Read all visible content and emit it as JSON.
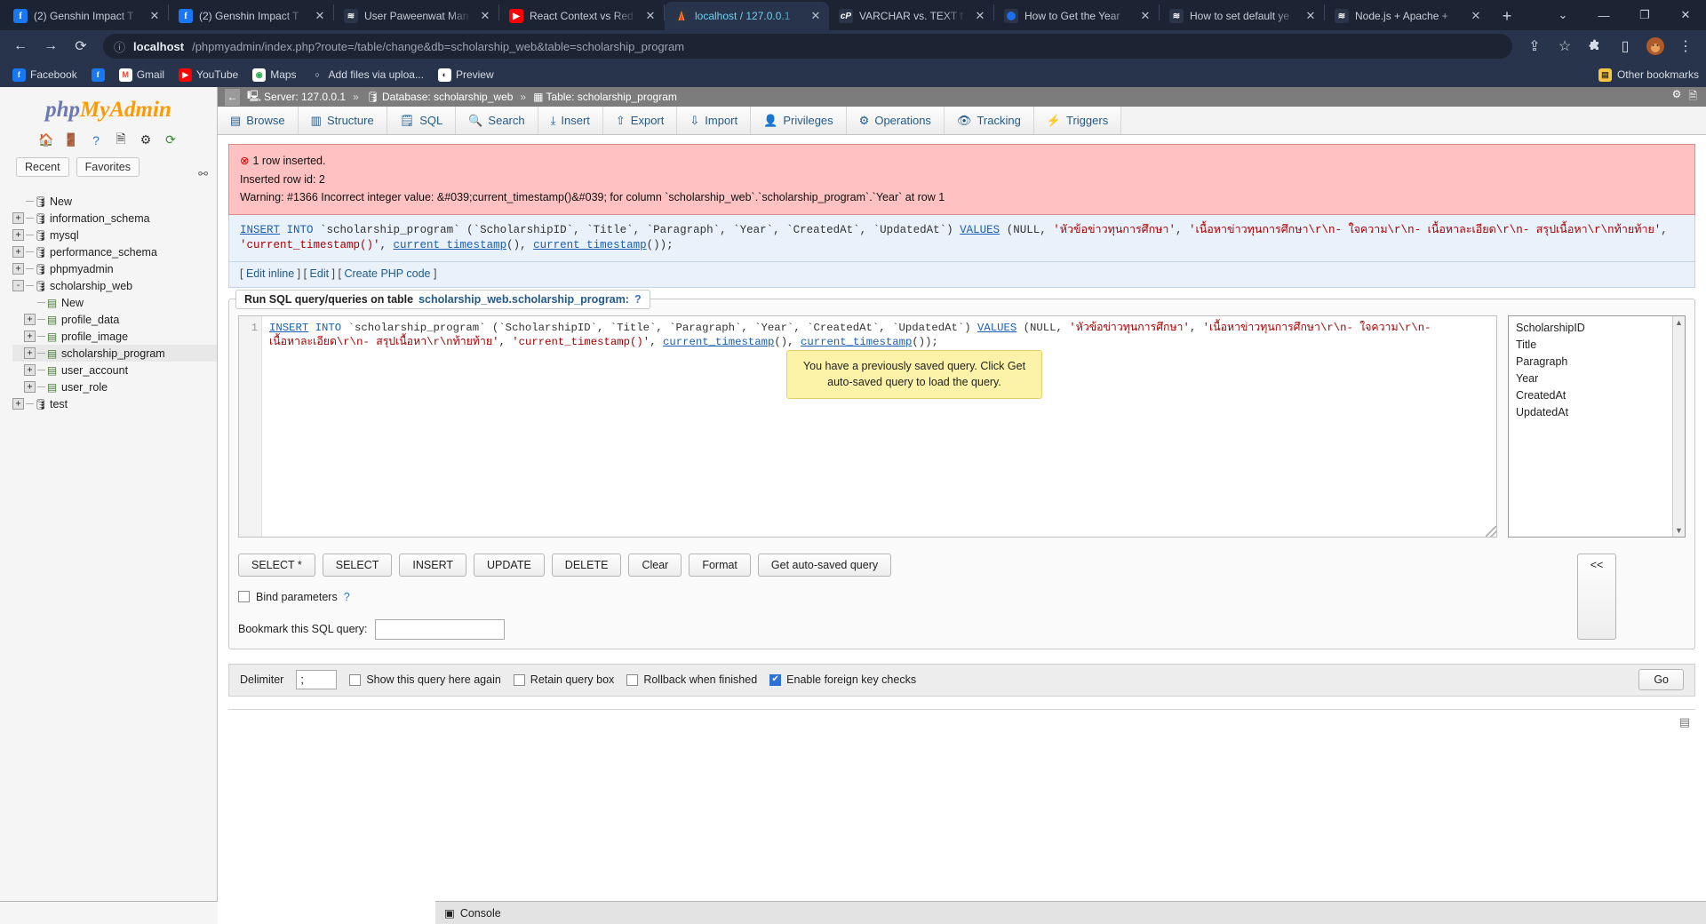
{
  "browser": {
    "tabs": [
      {
        "title": "(2) Genshin Impact T",
        "favicon": "facebook-icon",
        "active": false
      },
      {
        "title": "(2) Genshin Impact T",
        "favicon": "facebook-icon",
        "active": false
      },
      {
        "title": "User Paweenwat Man",
        "favicon": "stackoverflow-icon",
        "active": false
      },
      {
        "title": "React Context vs Red",
        "favicon": "youtube-icon",
        "active": false
      },
      {
        "title": "localhost / 127.0.0.1",
        "favicon": "phpmyadmin-icon",
        "active": true
      },
      {
        "title": "VARCHAR vs. TEXT f",
        "favicon": "cpanel-icon",
        "active": false
      },
      {
        "title": "How to Get the Year",
        "favicon": "dot-icon",
        "active": false
      },
      {
        "title": "How to set default ye",
        "favicon": "stackoverflow-icon",
        "active": false
      },
      {
        "title": "Node.js + Apache + ",
        "favicon": "stackoverflow-icon",
        "active": false
      }
    ],
    "new_tab_label": "+",
    "window_controls": {
      "list": "⌄",
      "minimize": "—",
      "maximize": "❐",
      "close": "✕"
    },
    "nav": {
      "back": "←",
      "forward": "→",
      "reload": "⟳"
    },
    "omnibox": {
      "info_icon": "ⓘ",
      "url_host": "localhost",
      "url_path": "/phpmyadmin/index.php?route=/table/change&db=scholarship_web&table=scholarship_program",
      "share_icon": "⇪",
      "star_icon": "☆",
      "extensions_icon": "🧩",
      "device_icon": "▯",
      "profile_icon": "🦊",
      "menu_icon": "⋮"
    },
    "bookmarks": [
      {
        "label": "Facebook",
        "icon": "facebook-icon"
      },
      {
        "label": "Gmail",
        "icon": "gmail-icon"
      },
      {
        "label": "YouTube",
        "icon": "youtube-icon"
      },
      {
        "label": "Maps",
        "icon": "maps-icon"
      },
      {
        "label": "Add files via uploa...",
        "icon": "github-icon"
      },
      {
        "label": "Preview",
        "icon": "preview-icon"
      }
    ],
    "other_bookmarks": {
      "label": "Other bookmarks",
      "icon": "folder-icon"
    }
  },
  "sidebar": {
    "logo": {
      "php": "php",
      "my": "My",
      "admin": "Admin"
    },
    "logo_icons": [
      "home-icon",
      "logout-icon",
      "docs-icon",
      "wiki-icon",
      "settings-icon",
      "reload-icon"
    ],
    "pin_icon": "pin-icon",
    "buttons": {
      "recent": "Recent",
      "favorites": "Favorites"
    },
    "tree": [
      {
        "label": "New",
        "level": 0,
        "expander": "",
        "icon": "new-db-icon",
        "selected": false
      },
      {
        "label": "information_schema",
        "level": 0,
        "expander": "+",
        "icon": "db-icon",
        "selected": false
      },
      {
        "label": "mysql",
        "level": 0,
        "expander": "+",
        "icon": "db-icon",
        "selected": false
      },
      {
        "label": "performance_schema",
        "level": 0,
        "expander": "+",
        "icon": "db-icon",
        "selected": false
      },
      {
        "label": "phpmyadmin",
        "level": 0,
        "expander": "+",
        "icon": "db-icon",
        "selected": false
      },
      {
        "label": "scholarship_web",
        "level": 0,
        "expander": "-",
        "icon": "db-icon",
        "selected": false
      },
      {
        "label": "New",
        "level": 1,
        "expander": "",
        "icon": "new-table-icon",
        "selected": false
      },
      {
        "label": "profile_data",
        "level": 1,
        "expander": "+",
        "icon": "table-icon",
        "selected": false
      },
      {
        "label": "profile_image",
        "level": 1,
        "expander": "+",
        "icon": "table-icon",
        "selected": false
      },
      {
        "label": "scholarship_program",
        "level": 1,
        "expander": "+",
        "icon": "table-icon",
        "selected": true
      },
      {
        "label": "user_account",
        "level": 1,
        "expander": "+",
        "icon": "table-icon",
        "selected": false
      },
      {
        "label": "user_role",
        "level": 1,
        "expander": "+",
        "icon": "table-icon",
        "selected": false
      },
      {
        "label": "test",
        "level": 0,
        "expander": "+",
        "icon": "db-icon",
        "selected": false
      }
    ]
  },
  "breadcrumb": {
    "back_icon": "←",
    "server": "Server: 127.0.0.1",
    "database": "Database: scholarship_web",
    "table": "Table: scholarship_program",
    "separator": "»",
    "right_icons": [
      "settings-icon",
      "docs-icon"
    ]
  },
  "tabs": [
    {
      "label": "Browse",
      "icon": "browse-icon"
    },
    {
      "label": "Structure",
      "icon": "structure-icon"
    },
    {
      "label": "SQL",
      "icon": "sql-icon"
    },
    {
      "label": "Search",
      "icon": "search-icon"
    },
    {
      "label": "Insert",
      "icon": "insert-icon"
    },
    {
      "label": "Export",
      "icon": "export-icon"
    },
    {
      "label": "Import",
      "icon": "import-icon"
    },
    {
      "label": "Privileges",
      "icon": "privileges-icon"
    },
    {
      "label": "Operations",
      "icon": "operations-icon"
    },
    {
      "label": "Tracking",
      "icon": "tracking-icon"
    },
    {
      "label": "Triggers",
      "icon": "triggers-icon"
    }
  ],
  "alert": {
    "icon": "error-icon",
    "line1": "1 row inserted.",
    "line2": "Inserted row id: 2",
    "line3": "Warning: #1366 Incorrect integer value: &#039;current_timestamp()&#039; for column `scholarship_web`.`scholarship_program`.`Year` at row 1"
  },
  "sql_echo": {
    "links": {
      "edit_inline": "Edit inline",
      "edit": "Edit",
      "create_php": "Create PHP code"
    }
  },
  "tooltip": {
    "text": "You have a previously saved query. Click Get auto-saved query to load the query."
  },
  "sqlbox": {
    "legend_prefix": "Run SQL query/queries on table",
    "legend_table": "scholarship_web.scholarship_program:",
    "help_icon": "help-icon",
    "line_number": "1",
    "query": "INSERT INTO `scholarship_program` (`ScholarshipID`, `Title`, `Paragraph`, `Year`, `CreatedAt`, `UpdatedAt`) VALUES (NULL, 'หัวข้อข่าวทุนการศึกษา', 'เนื้อหาข่าวทุนการศึกษา\\r\\n- ใจความ\\r\\n- เนื้อหาละเอียด\\r\\n- สรุปเนื้อหา\\r\\nท้ายท้าย', 'current_timestamp()', current_timestamp(), current_timestamp());",
    "columns": [
      "ScholarshipID",
      "Title",
      "Paragraph",
      "Year",
      "CreatedAt",
      "UpdatedAt"
    ],
    "buttons": [
      "SELECT *",
      "SELECT",
      "INSERT",
      "UPDATE",
      "DELETE",
      "Clear",
      "Format",
      "Get auto-saved query"
    ],
    "back_button": "<<",
    "bind_parameters": {
      "label": "Bind parameters",
      "checked": false,
      "help_icon": "help-icon"
    },
    "bookmark": {
      "label": "Bookmark this SQL query:",
      "value": "",
      "placeholder": ""
    }
  },
  "delimiter_bar": {
    "label": "Delimiter",
    "value": ";",
    "options": [
      {
        "label": "Show this query here again",
        "checked": false
      },
      {
        "label": "Retain query box",
        "checked": false
      },
      {
        "label": "Rollback when finished",
        "checked": false
      },
      {
        "label": "Enable foreign key checks",
        "checked": true
      }
    ],
    "go_button": "Go"
  },
  "console": {
    "label": "Console",
    "icon": "console-icon"
  },
  "colors": {
    "alert_bg": "#ffc1c1",
    "tooltip_bg": "#fdf3a8",
    "breadcrumb_bg": "#7c7c7c",
    "accent_blue": "#235a8a",
    "checkbox_checked": "#2f72d6",
    "keyword": "#1a5fb4",
    "string": "#aa0000"
  }
}
